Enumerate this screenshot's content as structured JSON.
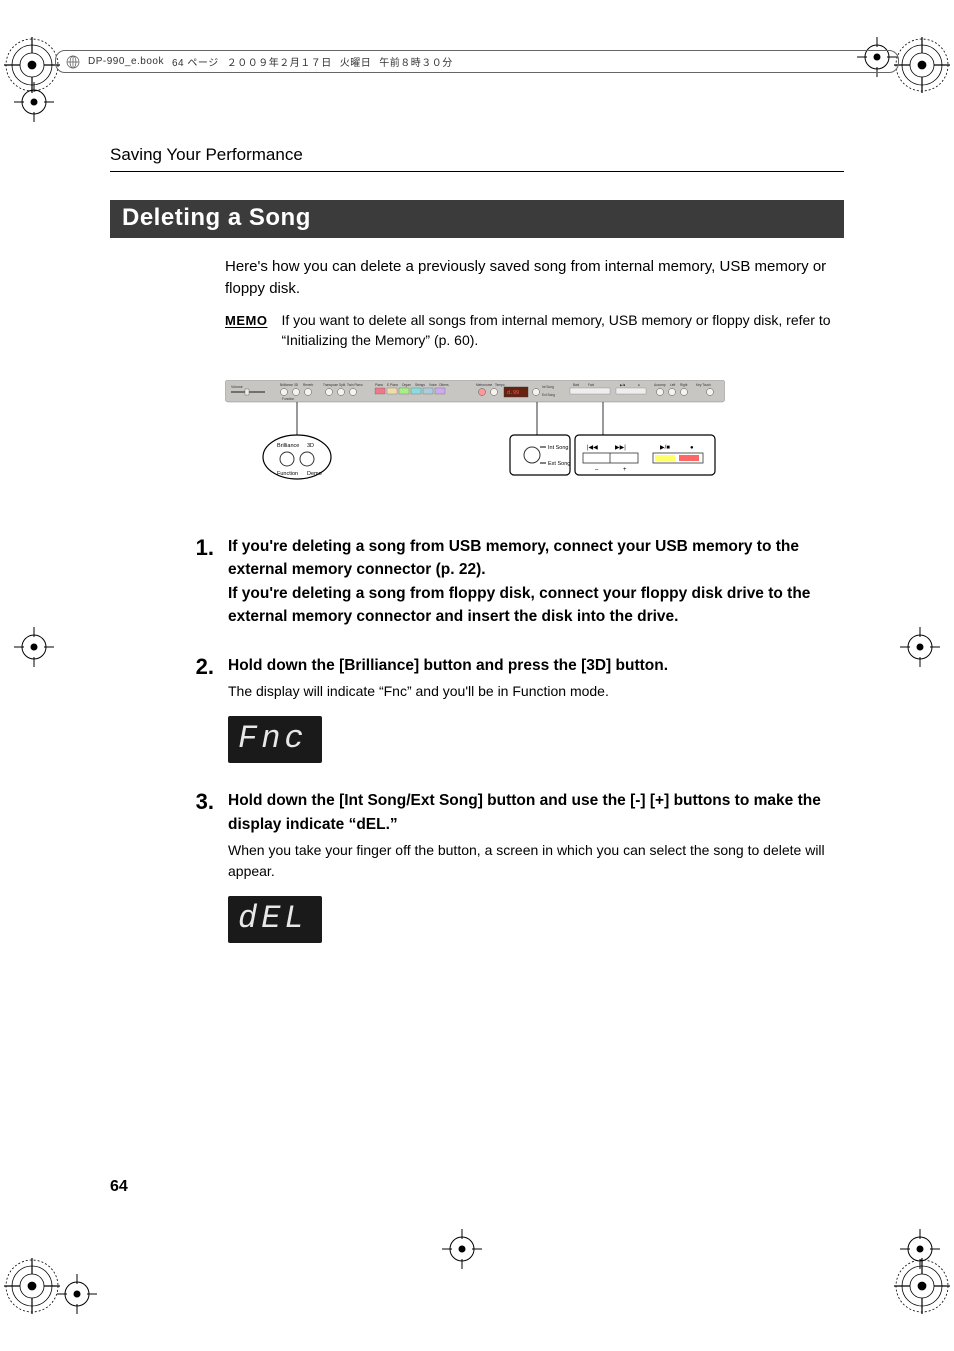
{
  "header": {
    "filename": "DP-990_e.book",
    "page_label": "64 ページ",
    "date": "２００９年２月１７日",
    "weekday": "火曜日",
    "time": "午前８時３０分"
  },
  "chapter_heading": "Saving Your Performance",
  "title": "Deleting a Song",
  "intro": "Here's how you can delete a previously saved song from internal memory, USB memory or floppy disk.",
  "memo": {
    "badge": "MEMO",
    "text": "If you want to delete all songs from internal memory, USB memory or floppy disk, refer to “Initializing the Memory” (p. 60)."
  },
  "panel": {
    "labels": {
      "volume": "Volume",
      "brilliance": "Brilliance",
      "three_d": "3D",
      "reverb": "Reverb",
      "transpose": "Transpose",
      "split": "Split",
      "twin_piano": "Twin Piano",
      "function": "Function",
      "demo": "Demo",
      "tones_header": "",
      "tone_piano": "Piano",
      "tone_epiano": "E.Piano",
      "tone_organ": "Organ",
      "tone_strings": "Strings",
      "tone_voice": "Voice",
      "tone_others": "Others",
      "metronome": "Metronome",
      "tempo": "Tempo",
      "int_song": "Int Song",
      "ext_song": "Ext Song",
      "bwd": "Bwd",
      "fwd": "Fwd",
      "play_stop": "▶/■",
      "rec": "●",
      "track_accomp": "Accomp",
      "track_left": "Left",
      "track_right": "Right",
      "key_touch": "Key Touch"
    },
    "display_value": "d.99"
  },
  "callouts": {
    "left": {
      "brilliance": "Brilliance",
      "three_d": "3D",
      "function": "Function",
      "demo": "Demo"
    },
    "mid": {
      "int_song": "Int Song",
      "ext_song": "Ext Song"
    },
    "right": {
      "bwd": "|◀◀",
      "fwd": "▶▶|",
      "play_stop": "▶/■",
      "rec": "●",
      "minus": "–",
      "plus": "+"
    }
  },
  "steps": [
    {
      "num": "1",
      "head": "If you're deleting a song from USB memory, connect your USB memory to the external memory connector (p. 22).\nIf you're deleting a song from floppy disk, connect your floppy disk drive to the external memory connector and insert the disk into the drive.",
      "sub": "",
      "lcd": ""
    },
    {
      "num": "2",
      "head": "Hold down the [Brilliance] button and press the [3D] button.",
      "sub": "The display will indicate “Fnc” and you'll be in Function mode.",
      "lcd": "Fnc"
    },
    {
      "num": "3",
      "head": "Hold down the [Int Song/Ext Song] button and use the [-] [+] buttons to make the display indicate “dEL.”",
      "sub": "When you take your finger off the button, a screen in which you can select the song to delete will appear.",
      "lcd": "dEL"
    }
  ],
  "page_number": "64"
}
